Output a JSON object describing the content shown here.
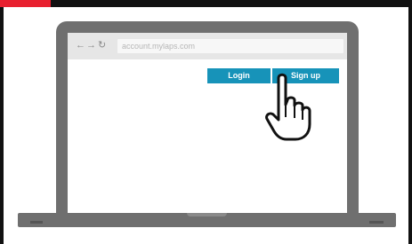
{
  "browser": {
    "back_glyph": "←",
    "forward_glyph": "→",
    "reload_glyph": "↻",
    "url": "account.mylaps.com"
  },
  "buttons": {
    "login_label": "Login",
    "signup_label": "Sign up"
  },
  "icons": [
    "back-arrow-icon",
    "forward-arrow-icon",
    "reload-icon",
    "hand-cursor-icon"
  ],
  "colors": {
    "accent_red": "#e8202f",
    "button_blue": "#1793b9",
    "laptop_gray": "#6f6f6f",
    "browser_bar": "#e6e6e6"
  }
}
